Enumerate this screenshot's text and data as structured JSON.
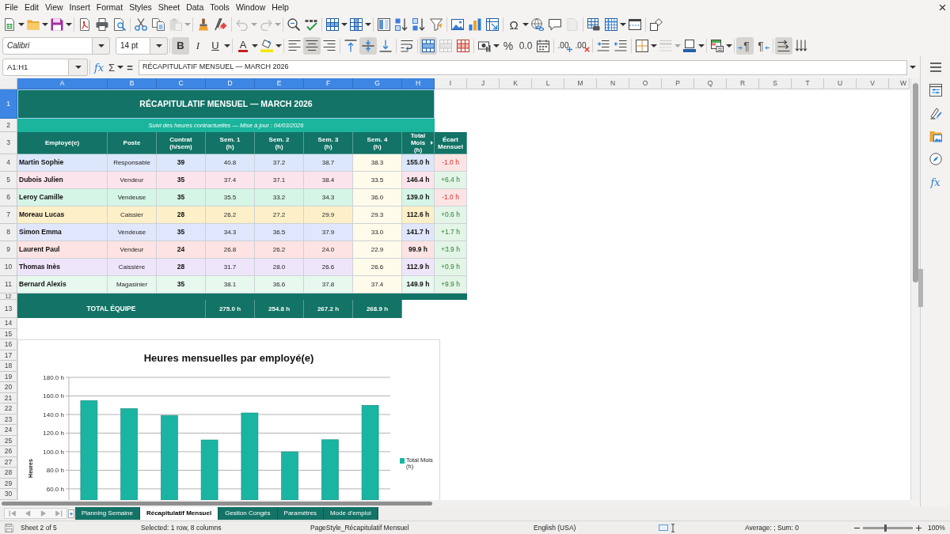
{
  "menu_bar": [
    "File",
    "Edit",
    "View",
    "Insert",
    "Format",
    "Styles",
    "Sheet",
    "Data",
    "Tools",
    "Window",
    "Help"
  ],
  "standard_toolbar": {
    "paste": {
      "disabled": true
    },
    "undo": {
      "disabled": true
    },
    "redo": {
      "disabled": true
    },
    "special_character": "Ω",
    "header_footer": {
      "disabled": true
    }
  },
  "formatting_toolbar": {
    "font_name": "Calibri",
    "font_size": "14 pt",
    "bold": {
      "label": "B",
      "on": true
    },
    "italic": {
      "label": "I",
      "on": false
    },
    "underline": {
      "label": "U",
      "on": false
    },
    "font_color": {
      "label": "A"
    },
    "align_left": {
      "on": false
    },
    "align_center": {
      "on": true
    },
    "align_right": {
      "on": false
    },
    "align_top": {
      "on": false
    },
    "align_middle": {
      "on": true
    },
    "align_bottom": {
      "on": false
    },
    "wrap_text": {
      "on": false
    },
    "merge_center": {
      "on": true
    },
    "merge_cells": {
      "disabled": true
    },
    "percent": "%",
    "number": "0.0",
    "add_decimal": ".00",
    "delete_decimal": ".00",
    "border_style": {
      "disabled": true
    },
    "left_to_right": {
      "label": "¶",
      "on": true
    },
    "right_to_left": {
      "label": "¶",
      "on": false
    },
    "text_direction": {
      "on": true
    },
    "vertical_text": {
      "on": false
    }
  },
  "formula_bar": {
    "name_box": "A1:H1",
    "function_wizard": "fx",
    "sum": "Σ",
    "equals": "=",
    "formula": "RÉCAPITULATIF MENSUEL — MARCH 2026"
  },
  "sidebar": {
    "functions": "fx"
  },
  "column_headers": [
    {
      "label": "A",
      "selected": true
    },
    {
      "label": "B",
      "selected": true
    },
    {
      "label": "C",
      "selected": true
    },
    {
      "label": "D",
      "selected": true
    },
    {
      "label": "E",
      "selected": true
    },
    {
      "label": "F",
      "selected": true
    },
    {
      "label": "G",
      "selected": true
    },
    {
      "label": "H",
      "selected": true
    },
    {
      "label": "I",
      "selected": false
    },
    {
      "label": "J",
      "selected": false
    },
    {
      "label": "K",
      "selected": false
    },
    {
      "label": "L",
      "selected": false
    },
    {
      "label": "M",
      "selected": false
    },
    {
      "label": "N",
      "selected": false
    },
    {
      "label": "O",
      "selected": false
    },
    {
      "label": "P",
      "selected": false
    },
    {
      "label": "Q",
      "selected": false
    },
    {
      "label": "R",
      "selected": false
    },
    {
      "label": "S",
      "selected": false
    },
    {
      "label": "T",
      "selected": false
    },
    {
      "label": "U",
      "selected": false
    },
    {
      "label": "V",
      "selected": false
    },
    {
      "label": "W",
      "selected": false
    }
  ],
  "row_headers": [
    {
      "label": "1",
      "selected": true
    },
    {
      "label": "2",
      "selected": false
    },
    {
      "label": "3",
      "selected": false
    },
    {
      "label": "4",
      "selected": false
    },
    {
      "label": "5",
      "selected": false
    },
    {
      "label": "6",
      "selected": false
    },
    {
      "label": "7",
      "selected": false
    },
    {
      "label": "8",
      "selected": false
    },
    {
      "label": "9",
      "selected": false
    },
    {
      "label": "10",
      "selected": false
    },
    {
      "label": "11",
      "selected": false
    },
    {
      "label": "12",
      "selected": false
    },
    {
      "label": "13",
      "selected": false
    },
    {
      "label": "14",
      "selected": false
    },
    {
      "label": "15",
      "selected": false
    },
    {
      "label": "16",
      "selected": false
    },
    {
      "label": "17",
      "selected": false
    },
    {
      "label": "18",
      "selected": false
    },
    {
      "label": "19",
      "selected": false
    },
    {
      "label": "20",
      "selected": false
    },
    {
      "label": "21",
      "selected": false
    },
    {
      "label": "22",
      "selected": false
    },
    {
      "label": "23",
      "selected": false
    },
    {
      "label": "24",
      "selected": false
    },
    {
      "label": "25",
      "selected": false
    },
    {
      "label": "26",
      "selected": false
    },
    {
      "label": "27",
      "selected": false
    },
    {
      "label": "28",
      "selected": false
    },
    {
      "label": "29",
      "selected": false
    },
    {
      "label": "30",
      "selected": false
    }
  ],
  "sheet": {
    "title": {
      "text": "RÉCAPITULATIF MENSUEL — MARCH 2026",
      "selected": true
    },
    "subtitle": "Suivi des heures contractuelles — Mise à jour : 04/03/2026",
    "header": [
      "Employé(e)",
      "Poste",
      "Contrat\n(h/sem)",
      "Sem. 1\n(h)",
      "Sem. 2\n(h)",
      "Sem. 3\n(h)",
      "Sem. 4\n(h)",
      "Total\nMois\n(h)",
      "Écart\nMensuel"
    ],
    "rows": [
      {
        "employee": "Martin Sophie",
        "position": "Responsable",
        "contract": "39",
        "weeks": [
          "40.8",
          "37.2",
          "38.7",
          "38.3"
        ],
        "total": "155.0 h",
        "gap": "-1.0 h",
        "deficit": true,
        "color": "#dce7fb"
      },
      {
        "employee": "Dubois Julien",
        "position": "Vendeur",
        "contract": "35",
        "weeks": [
          "37.4",
          "37.1",
          "38.4",
          "33.5"
        ],
        "total": "146.4 h",
        "gap": "+6.4 h",
        "deficit": false,
        "color": "#fce4ec"
      },
      {
        "employee": "Leroy Camille",
        "position": "Vendeuse",
        "contract": "35",
        "weeks": [
          "35.5",
          "33.2",
          "34.3",
          "36.0"
        ],
        "total": "139.0 h",
        "gap": "-1.0 h",
        "deficit": true,
        "color": "#d5f5e6"
      },
      {
        "employee": "Moreau Lucas",
        "position": "Caissier",
        "contract": "28",
        "weeks": [
          "26.2",
          "27.2",
          "29.9",
          "29.3"
        ],
        "total": "112.6 h",
        "gap": "+0.6 h",
        "deficit": false,
        "color": "#fdf0c9"
      },
      {
        "employee": "Simon Emma",
        "position": "Vendeuse",
        "contract": "35",
        "weeks": [
          "34.3",
          "36.5",
          "37.9",
          "33.0"
        ],
        "total": "141.7 h",
        "gap": "+1.7 h",
        "deficit": false,
        "color": "#e0e6fb"
      },
      {
        "employee": "Laurent Paul",
        "position": "Vendeur",
        "contract": "24",
        "weeks": [
          "26.8",
          "26.2",
          "24.0",
          "22.9"
        ],
        "total": "99.9 h",
        "gap": "+3.9 h",
        "deficit": false,
        "color": "#fde3e3"
      },
      {
        "employee": "Thomas Inès",
        "position": "Caissière",
        "contract": "28",
        "weeks": [
          "31.7",
          "28.0",
          "26.6",
          "26.6"
        ],
        "total": "112.9 h",
        "gap": "+0.9 h",
        "deficit": false,
        "color": "#eee5fb"
      },
      {
        "employee": "Bernard Alexis",
        "position": "Magasinier",
        "contract": "35",
        "weeks": [
          "38.1",
          "36.6",
          "37.8",
          "37.4"
        ],
        "total": "149.9 h",
        "gap": "+9.9 h",
        "deficit": false,
        "color": "#e7f8ef"
      }
    ],
    "total": {
      "label": "TOTAL ÉQUIPE",
      "weeks": [
        "275.0 h",
        "254.8 h",
        "267.2 h",
        "268.9 h"
      ]
    }
  },
  "chart": {
    "chart_data": {
      "type": "bar",
      "title": "Heures mensuelles par employé(e)",
      "ylabel": "Heures",
      "ylim": [
        48,
        180
      ],
      "yticks": [
        {
          "value": 60,
          "label": "60.0 h"
        },
        {
          "value": 80,
          "label": "80.0 h"
        },
        {
          "value": 100,
          "label": "100.0 h"
        },
        {
          "value": 120,
          "label": "120.0 h"
        },
        {
          "value": 140,
          "label": "140.0 h"
        },
        {
          "value": 160,
          "label": "160.0 h"
        },
        {
          "value": 180,
          "label": "180.0 h"
        }
      ],
      "grid": true,
      "series": [
        {
          "name": "Total Mois (h)",
          "color": "#1ab5a2",
          "values": [
            155.0,
            146.4,
            139.0,
            112.6,
            141.7,
            99.9,
            112.9,
            149.9
          ]
        }
      ]
    }
  },
  "sheet_tabs": [
    {
      "label": "Planning Semaine",
      "selected": false
    },
    {
      "label": "Récapitulatif Mensuel",
      "selected": true
    },
    {
      "label": "Gestion Congés",
      "selected": false
    },
    {
      "label": "Paramètres",
      "selected": false
    },
    {
      "label": "Mode d'emploi",
      "selected": false
    }
  ],
  "status_bar": {
    "sheet": "Sheet 2 of 5",
    "selection": "Selected: 1 row, 8 columns",
    "page_style": "PageStyle_Récapitulatif Mensuel",
    "language": "English (USA)",
    "summary": "Average: ; Sum: 0",
    "zoom_slider": {
      "level": 0.45
    },
    "zoom": "100%"
  }
}
